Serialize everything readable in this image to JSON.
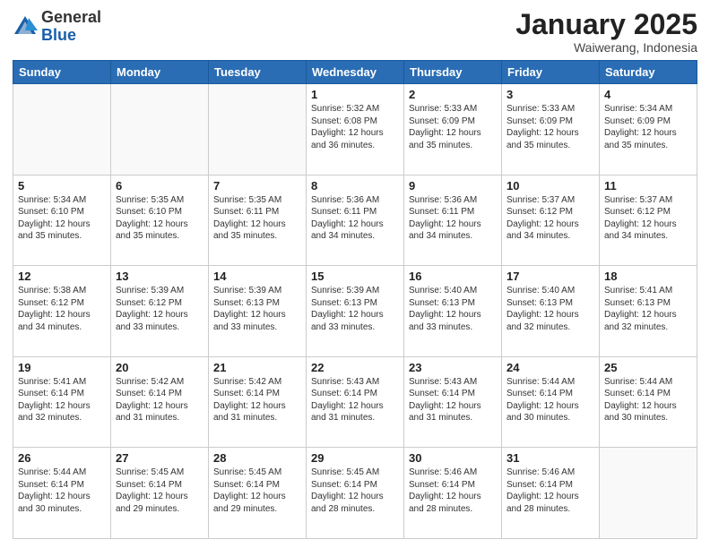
{
  "header": {
    "logo_general": "General",
    "logo_blue": "Blue",
    "month_title": "January 2025",
    "subtitle": "Waiwerang, Indonesia"
  },
  "days_of_week": [
    "Sunday",
    "Monday",
    "Tuesday",
    "Wednesday",
    "Thursday",
    "Friday",
    "Saturday"
  ],
  "weeks": [
    [
      {
        "day": "",
        "info": ""
      },
      {
        "day": "",
        "info": ""
      },
      {
        "day": "",
        "info": ""
      },
      {
        "day": "1",
        "info": "Sunrise: 5:32 AM\nSunset: 6:08 PM\nDaylight: 12 hours and 36 minutes."
      },
      {
        "day": "2",
        "info": "Sunrise: 5:33 AM\nSunset: 6:09 PM\nDaylight: 12 hours and 35 minutes."
      },
      {
        "day": "3",
        "info": "Sunrise: 5:33 AM\nSunset: 6:09 PM\nDaylight: 12 hours and 35 minutes."
      },
      {
        "day": "4",
        "info": "Sunrise: 5:34 AM\nSunset: 6:09 PM\nDaylight: 12 hours and 35 minutes."
      }
    ],
    [
      {
        "day": "5",
        "info": "Sunrise: 5:34 AM\nSunset: 6:10 PM\nDaylight: 12 hours and 35 minutes."
      },
      {
        "day": "6",
        "info": "Sunrise: 5:35 AM\nSunset: 6:10 PM\nDaylight: 12 hours and 35 minutes."
      },
      {
        "day": "7",
        "info": "Sunrise: 5:35 AM\nSunset: 6:11 PM\nDaylight: 12 hours and 35 minutes."
      },
      {
        "day": "8",
        "info": "Sunrise: 5:36 AM\nSunset: 6:11 PM\nDaylight: 12 hours and 34 minutes."
      },
      {
        "day": "9",
        "info": "Sunrise: 5:36 AM\nSunset: 6:11 PM\nDaylight: 12 hours and 34 minutes."
      },
      {
        "day": "10",
        "info": "Sunrise: 5:37 AM\nSunset: 6:12 PM\nDaylight: 12 hours and 34 minutes."
      },
      {
        "day": "11",
        "info": "Sunrise: 5:37 AM\nSunset: 6:12 PM\nDaylight: 12 hours and 34 minutes."
      }
    ],
    [
      {
        "day": "12",
        "info": "Sunrise: 5:38 AM\nSunset: 6:12 PM\nDaylight: 12 hours and 34 minutes."
      },
      {
        "day": "13",
        "info": "Sunrise: 5:39 AM\nSunset: 6:12 PM\nDaylight: 12 hours and 33 minutes."
      },
      {
        "day": "14",
        "info": "Sunrise: 5:39 AM\nSunset: 6:13 PM\nDaylight: 12 hours and 33 minutes."
      },
      {
        "day": "15",
        "info": "Sunrise: 5:39 AM\nSunset: 6:13 PM\nDaylight: 12 hours and 33 minutes."
      },
      {
        "day": "16",
        "info": "Sunrise: 5:40 AM\nSunset: 6:13 PM\nDaylight: 12 hours and 33 minutes."
      },
      {
        "day": "17",
        "info": "Sunrise: 5:40 AM\nSunset: 6:13 PM\nDaylight: 12 hours and 32 minutes."
      },
      {
        "day": "18",
        "info": "Sunrise: 5:41 AM\nSunset: 6:13 PM\nDaylight: 12 hours and 32 minutes."
      }
    ],
    [
      {
        "day": "19",
        "info": "Sunrise: 5:41 AM\nSunset: 6:14 PM\nDaylight: 12 hours and 32 minutes."
      },
      {
        "day": "20",
        "info": "Sunrise: 5:42 AM\nSunset: 6:14 PM\nDaylight: 12 hours and 31 minutes."
      },
      {
        "day": "21",
        "info": "Sunrise: 5:42 AM\nSunset: 6:14 PM\nDaylight: 12 hours and 31 minutes."
      },
      {
        "day": "22",
        "info": "Sunrise: 5:43 AM\nSunset: 6:14 PM\nDaylight: 12 hours and 31 minutes."
      },
      {
        "day": "23",
        "info": "Sunrise: 5:43 AM\nSunset: 6:14 PM\nDaylight: 12 hours and 31 minutes."
      },
      {
        "day": "24",
        "info": "Sunrise: 5:44 AM\nSunset: 6:14 PM\nDaylight: 12 hours and 30 minutes."
      },
      {
        "day": "25",
        "info": "Sunrise: 5:44 AM\nSunset: 6:14 PM\nDaylight: 12 hours and 30 minutes."
      }
    ],
    [
      {
        "day": "26",
        "info": "Sunrise: 5:44 AM\nSunset: 6:14 PM\nDaylight: 12 hours and 30 minutes."
      },
      {
        "day": "27",
        "info": "Sunrise: 5:45 AM\nSunset: 6:14 PM\nDaylight: 12 hours and 29 minutes."
      },
      {
        "day": "28",
        "info": "Sunrise: 5:45 AM\nSunset: 6:14 PM\nDaylight: 12 hours and 29 minutes."
      },
      {
        "day": "29",
        "info": "Sunrise: 5:45 AM\nSunset: 6:14 PM\nDaylight: 12 hours and 28 minutes."
      },
      {
        "day": "30",
        "info": "Sunrise: 5:46 AM\nSunset: 6:14 PM\nDaylight: 12 hours and 28 minutes."
      },
      {
        "day": "31",
        "info": "Sunrise: 5:46 AM\nSunset: 6:14 PM\nDaylight: 12 hours and 28 minutes."
      },
      {
        "day": "",
        "info": ""
      }
    ]
  ]
}
